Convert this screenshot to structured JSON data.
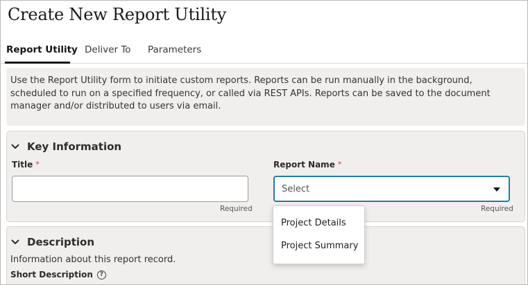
{
  "page": {
    "title": "Create New Report Utility"
  },
  "tabs": [
    {
      "label": "Report Utility",
      "active": true
    },
    {
      "label": "Deliver To",
      "active": false
    },
    {
      "label": "Parameters",
      "active": false
    }
  ],
  "intro_text": "Use the Report Utility form to initiate custom reports. Reports can be run manually in the background, scheduled to run on a specified frequency, or called via REST APIs. Reports can be saved to the document manager and/or distributed to users via email.",
  "key_information": {
    "heading": "Key Information",
    "title_field": {
      "label": "Title",
      "required_mark": "*",
      "value": "",
      "hint": "Required"
    },
    "report_name_field": {
      "label": "Report Name",
      "required_mark": "*",
      "value": "Select",
      "hint": "Required"
    }
  },
  "report_name_options": [
    "Project Details",
    "Project Summary"
  ],
  "description": {
    "heading": "Description",
    "text": "Information about this report record.",
    "short_description_label": "Short Description",
    "help_icon": "?"
  },
  "colors": {
    "accent": "#227e9e",
    "required_star": "#d03b3b",
    "panel_bg": "#f1efed"
  }
}
